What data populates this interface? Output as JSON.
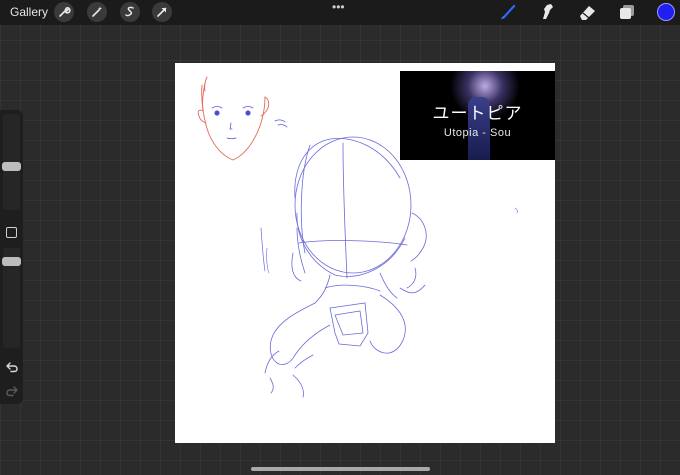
{
  "topbar": {
    "gallery_label": "Gallery",
    "left_tools": [
      {
        "name": "actions-wrench-icon"
      },
      {
        "name": "adjustments-wand-icon"
      },
      {
        "name": "selection-icon"
      },
      {
        "name": "transform-arrow-icon"
      }
    ],
    "more_label": "•••",
    "right_tools": [
      "brush-icon",
      "smudge-icon",
      "eraser-icon",
      "layers-icon"
    ],
    "current_color": "#1f1ff0"
  },
  "sidebar": {
    "brush_size_level": 0.45,
    "opacity_level": 0.35
  },
  "reference": {
    "title": "ユートピア",
    "subtitle": "Utopia - Sou"
  },
  "colors": {
    "sketch_blue": "#5a5ad6",
    "sketch_red": "#e06a5a",
    "accent": "#1f1ff0"
  }
}
